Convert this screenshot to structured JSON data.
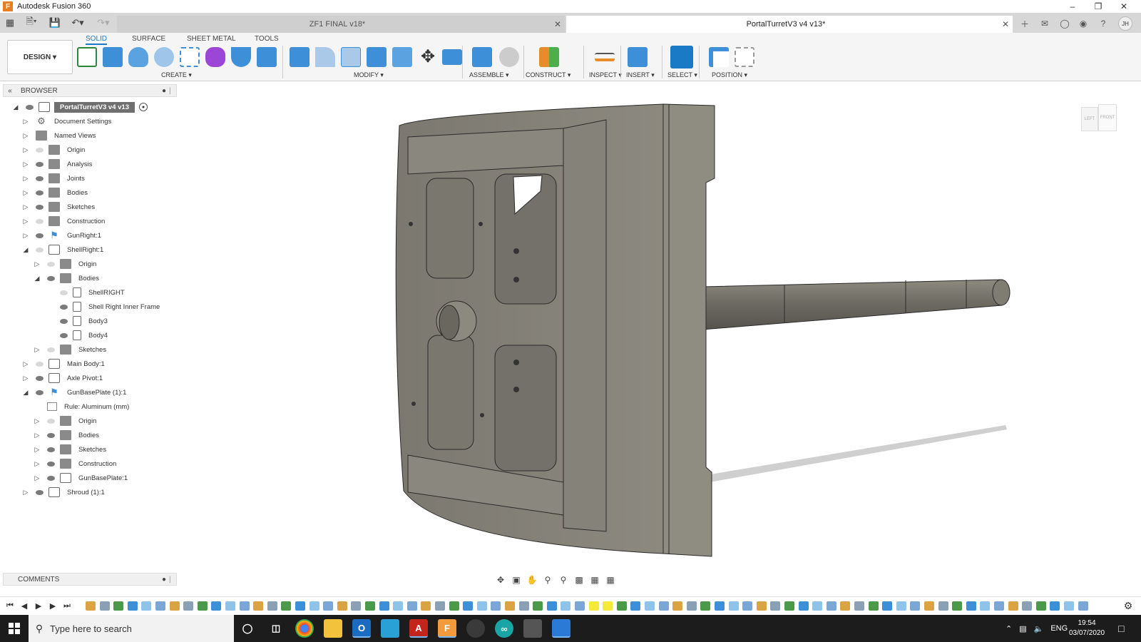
{
  "window": {
    "title": "Autodesk Fusion 360"
  },
  "tabs": [
    {
      "label": "ZF1 FINAL v18*",
      "active": false
    },
    {
      "label": "PortalTurretV3 v4 v13*",
      "active": true
    }
  ],
  "ribbon": {
    "workspace": "DESIGN",
    "tabs": [
      "SOLID",
      "SURFACE",
      "SHEET METAL",
      "TOOLS"
    ],
    "groups": {
      "create": "CREATE",
      "modify": "MODIFY",
      "assemble": "ASSEMBLE",
      "construct": "CONSTRUCT",
      "inspect": "INSPECT",
      "insert": "INSERT",
      "select": "SELECT",
      "position": "POSITION"
    }
  },
  "browser": {
    "title": "BROWSER",
    "root": "PortalTurretV3 v4 v13",
    "items": [
      {
        "label": "Document Settings"
      },
      {
        "label": "Named Views"
      },
      {
        "label": "Origin"
      },
      {
        "label": "Analysis"
      },
      {
        "label": "Joints"
      },
      {
        "label": "Bodies"
      },
      {
        "label": "Sketches"
      },
      {
        "label": "Construction"
      },
      {
        "label": "GunRight:1"
      },
      {
        "label": "ShellRight:1"
      },
      {
        "label": "Origin"
      },
      {
        "label": "Bodies"
      },
      {
        "label": "ShellRIGHT"
      },
      {
        "label": "Shell Right Inner Frame"
      },
      {
        "label": "Body3"
      },
      {
        "label": "Body4"
      },
      {
        "label": "Sketches"
      },
      {
        "label": "Main Body:1"
      },
      {
        "label": "Axle Pivot:1"
      },
      {
        "label": "GunBasePlate (1):1"
      },
      {
        "label": "Rule: Aluminum (mm)"
      },
      {
        "label": "Origin"
      },
      {
        "label": "Bodies"
      },
      {
        "label": "Sketches"
      },
      {
        "label": "Construction"
      },
      {
        "label": "GunBasePlate:1"
      },
      {
        "label": "Shroud (1):1"
      }
    ]
  },
  "viewcube": {
    "left": "LEFT",
    "front": "FRONT"
  },
  "comments": {
    "title": "COMMENTS"
  },
  "taskbar": {
    "search_placeholder": "Type here to search",
    "language": "ENG",
    "time": "19:54",
    "date": "03/07/2020"
  },
  "user": {
    "initials": "JH"
  }
}
